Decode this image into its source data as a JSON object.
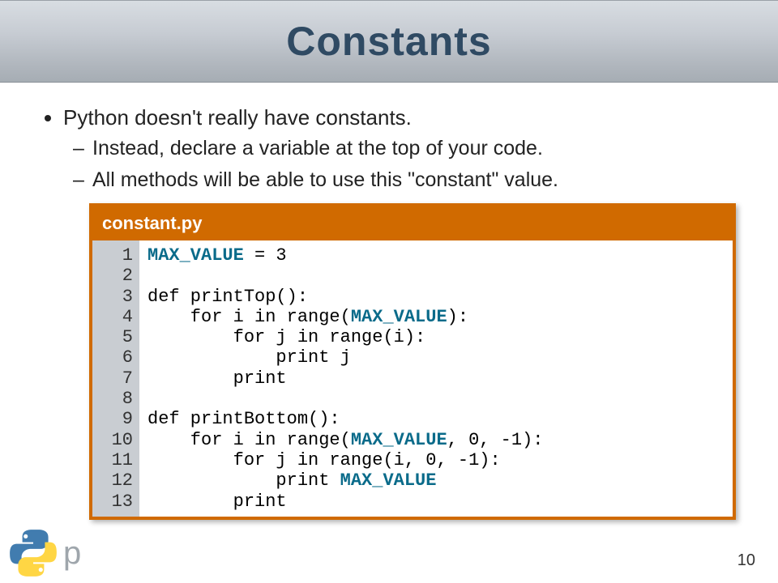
{
  "title": "Constants",
  "bullets": {
    "main": "Python doesn't really have constants.",
    "sub1": "Instead, declare a variable at the top of your code.",
    "sub2": "All methods will be able to use this \"constant\" value."
  },
  "codebox": {
    "filename": "constant.py",
    "line_numbers": " 1\n 2\n 3\n 4\n 5\n 6\n 7\n 8\n 9\n10\n11\n12\n13",
    "code": {
      "l1a": "MAX_VALUE",
      "l1b": " = 3",
      "l3": "def printTop():",
      "l4a": "    for i in range(",
      "l4b": "MAX_VALUE",
      "l4c": "):",
      "l5": "        for j in range(i):",
      "l6": "            print j",
      "l7": "        print",
      "l9": "def printBottom():",
      "l10a": "    for i in range(",
      "l10b": "MAX_VALUE",
      "l10c": ", 0, -1):",
      "l11": "        for j in range(i, 0, -1):",
      "l12a": "            print ",
      "l12b": "MAX_VALUE",
      "l13": "        print"
    }
  },
  "page_number": "10",
  "logo_text": "p"
}
